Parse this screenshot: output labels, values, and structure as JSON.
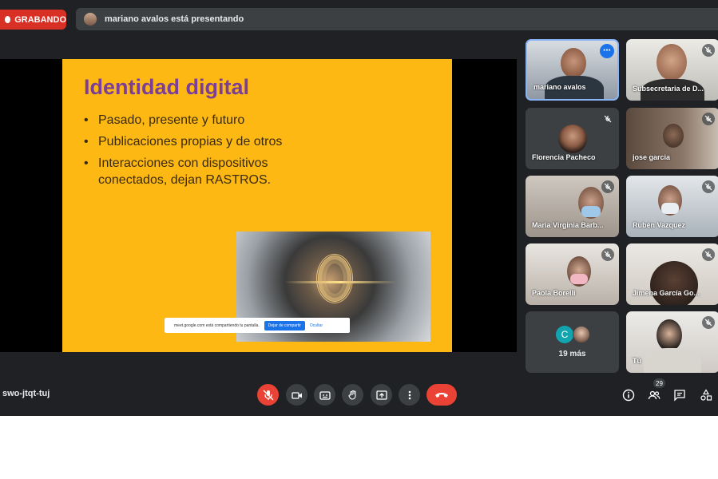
{
  "recording": {
    "label": "GRABANDO"
  },
  "presenter_banner": {
    "text": "mariano avalos está presentando"
  },
  "slide": {
    "title": "Identidad digital",
    "bullets": [
      "Pasado, presente y futuro",
      "Publicaciones propias y de otros",
      "Interacciones con dispositivos conectados, dejan RASTROS."
    ],
    "share_notice": {
      "text": "meet.google.com está compartiendo tu pantalla.",
      "stop_label": "Dejar de compartir",
      "hide_label": "Ocultar"
    }
  },
  "participants": [
    {
      "name": "mariano avalos"
    },
    {
      "name": "Subsecretaria de D..."
    },
    {
      "name": "Florencia Pacheco"
    },
    {
      "name": "jose garcia"
    },
    {
      "name": "Maria Virginia Barb..."
    },
    {
      "name": "Rubén Vazquez"
    },
    {
      "name": "Paola Borelli"
    },
    {
      "name": "Jimena García Go..."
    },
    {
      "name": "Tú"
    }
  ],
  "more_tile": {
    "avatar_letter": "C",
    "label": "19 más"
  },
  "meeting_code": "swo-jtqt-tuj",
  "people_count": "29",
  "colors": {
    "accent": "#1a73e8",
    "danger": "#ea4335",
    "slide_bg": "#fdb813",
    "slide_title": "#7b3f98",
    "bar_bg": "#202124",
    "tile_bg": "#3c4043"
  },
  "icons": [
    "mic-off-icon",
    "camera-icon",
    "captions-icon",
    "raise-hand-icon",
    "present-icon",
    "more-vert-icon",
    "end-call-icon",
    "info-icon",
    "people-icon",
    "chat-icon",
    "activities-icon"
  ]
}
